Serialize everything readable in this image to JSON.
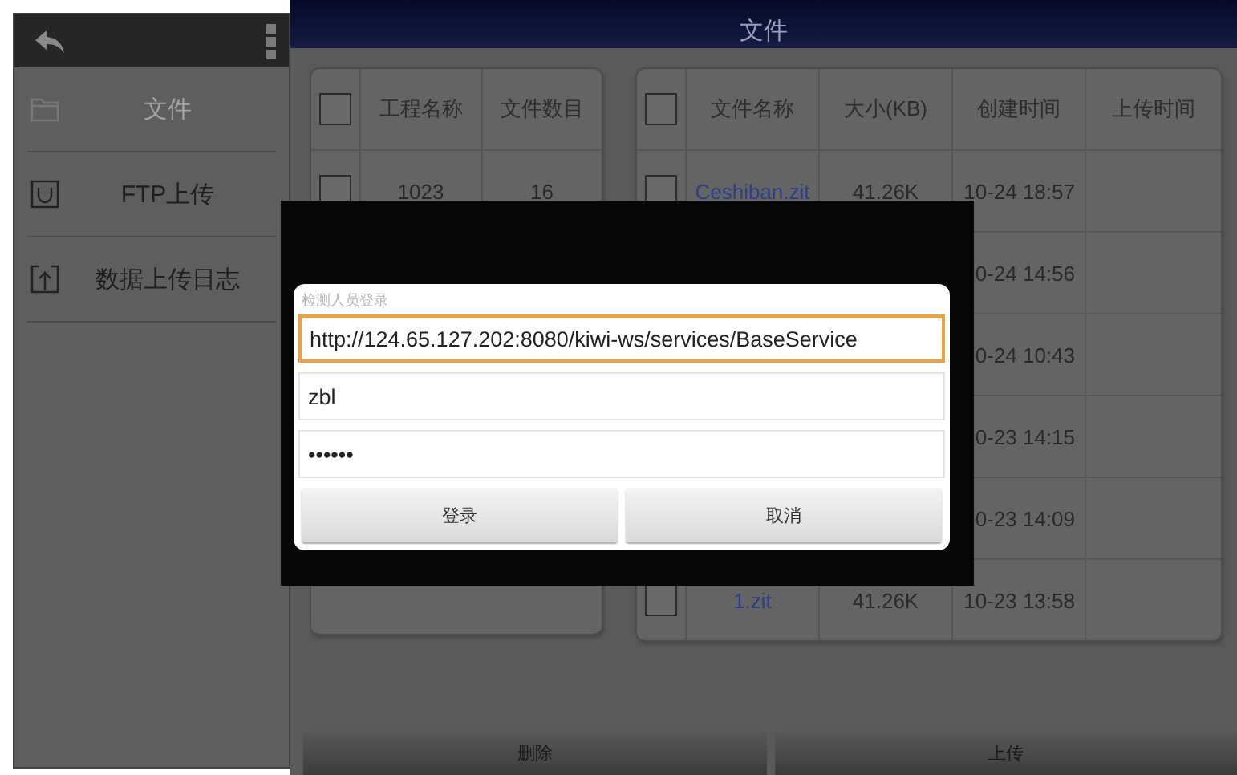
{
  "app_bar": {
    "title": "文件"
  },
  "sidebar": {
    "items": [
      {
        "label": "文件",
        "kind": "folder",
        "selected": true
      },
      {
        "label": "FTP上传",
        "kind": "tray",
        "selected": false
      },
      {
        "label": "数据上传日志",
        "kind": "upload",
        "selected": false
      }
    ]
  },
  "project_table": {
    "header_checked": false,
    "columns": [
      "工程名称",
      "文件数目"
    ],
    "rows": [
      {
        "checked": false,
        "cells": [
          "1023",
          "16"
        ]
      }
    ]
  },
  "file_table": {
    "header_checked": false,
    "columns": [
      "文件名称",
      "大小(KB)",
      "创建时间",
      "上传时间"
    ],
    "rows": [
      {
        "checked": false,
        "file_name": "Ceshiban.zit",
        "size": "41.26K",
        "created": "10-24 18:57"
      },
      {
        "created": "0-24 14:56"
      },
      {
        "created": "0-24 10:43"
      },
      {
        "created": "0-23 14:15"
      },
      {
        "created": "0-23 14:09"
      },
      {
        "checked": false,
        "file_name": "1.zit",
        "size": "41.26K",
        "created": "10-23 13:58"
      }
    ]
  },
  "dialog": {
    "title": "检测人员登录",
    "fields": [
      {
        "value": "http://124.65.127.202:8080/kiwi-ws/services/BaseService",
        "focused": true
      },
      {
        "value": "zbl",
        "focused": false
      },
      {
        "value": "••••••",
        "focused": false
      }
    ],
    "buttons": [
      "登录",
      "取消"
    ]
  },
  "bottom_buttons": [
    "删除",
    "上传"
  ]
}
